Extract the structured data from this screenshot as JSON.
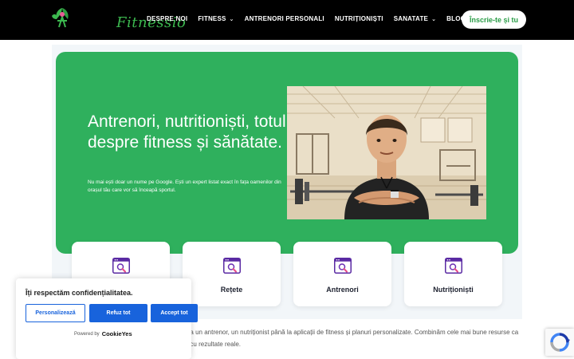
{
  "header": {
    "logo_text": "Fitnessio",
    "nav": [
      {
        "label": "DESPRE NOI",
        "caret": false
      },
      {
        "label": "FITNESS",
        "caret": true
      },
      {
        "label": "ANTRENORI PERSONALI",
        "caret": false
      },
      {
        "label": "NUTRIȚIONIȘTI",
        "caret": false
      },
      {
        "label": "SANATATE",
        "caret": true
      },
      {
        "label": "BLOG",
        "caret": false
      }
    ],
    "cta_label": "Înscrie-te și tu",
    "caret_glyph": "⌄"
  },
  "hero": {
    "title": "Antrenori, nutritioniști, totul despre fitness și sănătate.",
    "subtitle": "Nu mai ești doar un nume pe Google. Ești un expert listat exact în fața oamenilor din orașul tău care vor să înceapă sportul.",
    "image_icon": "personal-trainer-illustration"
  },
  "cards": [
    {
      "label": "",
      "icon": "search-window-icon"
    },
    {
      "label": "Rețete",
      "icon": "search-window-icon"
    },
    {
      "label": "Antrenori",
      "icon": "search-window-icon"
    },
    {
      "label": "Nutriționiști",
      "icon": "search-window-icon"
    }
  ],
  "body_text": "începe sau a-ți optimiza stilul de viață activ – de la un antrenor, un nutriționist până la aplicații de fitness și planuri personalizate. Combinăm cele mai bune resurse ca tu să-ți atingi obiectivele mai simplu, mai rapid și cu rezultate reale.",
  "cookie": {
    "title": "Îți respectăm confidențialitatea.",
    "customize": "Personalizează",
    "reject": "Refuz tot",
    "accept": "Accept tot",
    "powered_by": "Powered by",
    "brand": "CookieYes"
  },
  "colors": {
    "brand_green": "#2fb05d",
    "cookie_blue": "#1863dc",
    "icon_purple": "#6b2fb3",
    "icon_pink": "#e84a86"
  }
}
